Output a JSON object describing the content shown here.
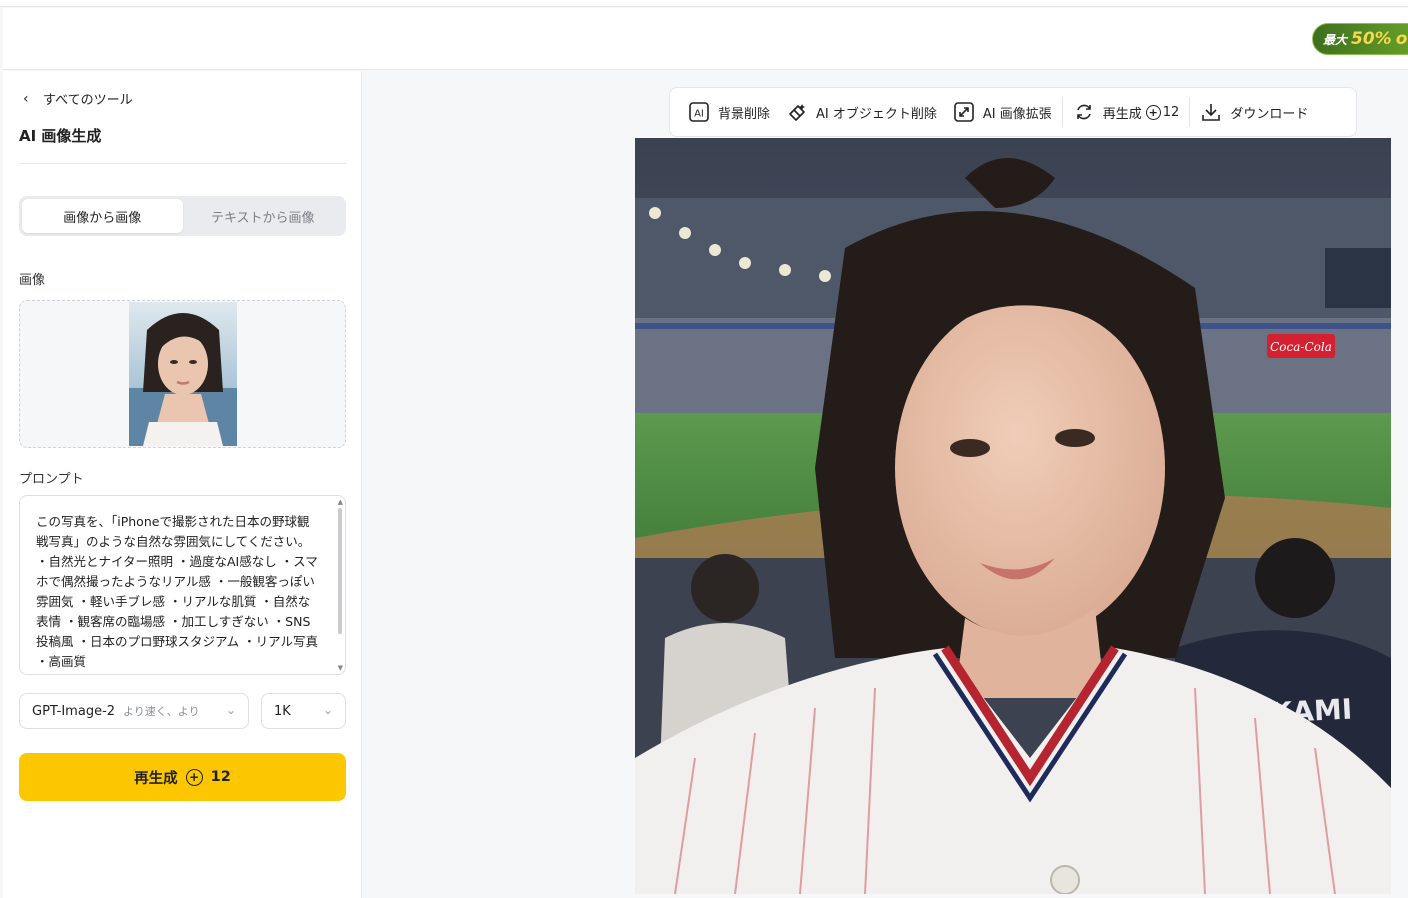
{
  "promo": {
    "prefix": "最大",
    "percent": "50%",
    "suffix": "o"
  },
  "sidebar": {
    "back_label": "すべてのツール",
    "title": "AI 画像生成",
    "modes": [
      "画像から画像",
      "テキストから画像"
    ],
    "active_mode": 0,
    "image_label": "画像",
    "prompt_label": "プロンプト",
    "prompt_text": "この写真を、「iPhoneで撮影された日本の野球観戦写真」のような自然な雰囲気にしてください。 ・自然光とナイター照明 ・過度なAI感なし ・スマホで偶然撮ったようなリアル感 ・一般観客っぽい雰囲気 ・軽い手ブレ感 ・リアルな肌質 ・自然な表情 ・観客席の臨場感 ・加工しすぎない ・SNS投稿風 ・日本のプロ野球スタジアム ・リアル写真 ・高画質",
    "model": {
      "name": "GPT-Image-2",
      "hint": "より速く、より"
    },
    "resolution": "1K",
    "generate_label": "再生成",
    "generate_cost": "12"
  },
  "toolbar": {
    "remove_bg": "背景削除",
    "remove_object": "AI オブジェクト削除",
    "upscale": "AI 画像拡張",
    "regenerate": "再生成",
    "regenerate_cost": "12",
    "download": "ダウンロード"
  },
  "canvas": {
    "jersey_text": "MURAKAMI",
    "billboard_text": "Coca-Cola"
  },
  "colors": {
    "accent": "#fdc700",
    "promo": "#4f8a24"
  }
}
